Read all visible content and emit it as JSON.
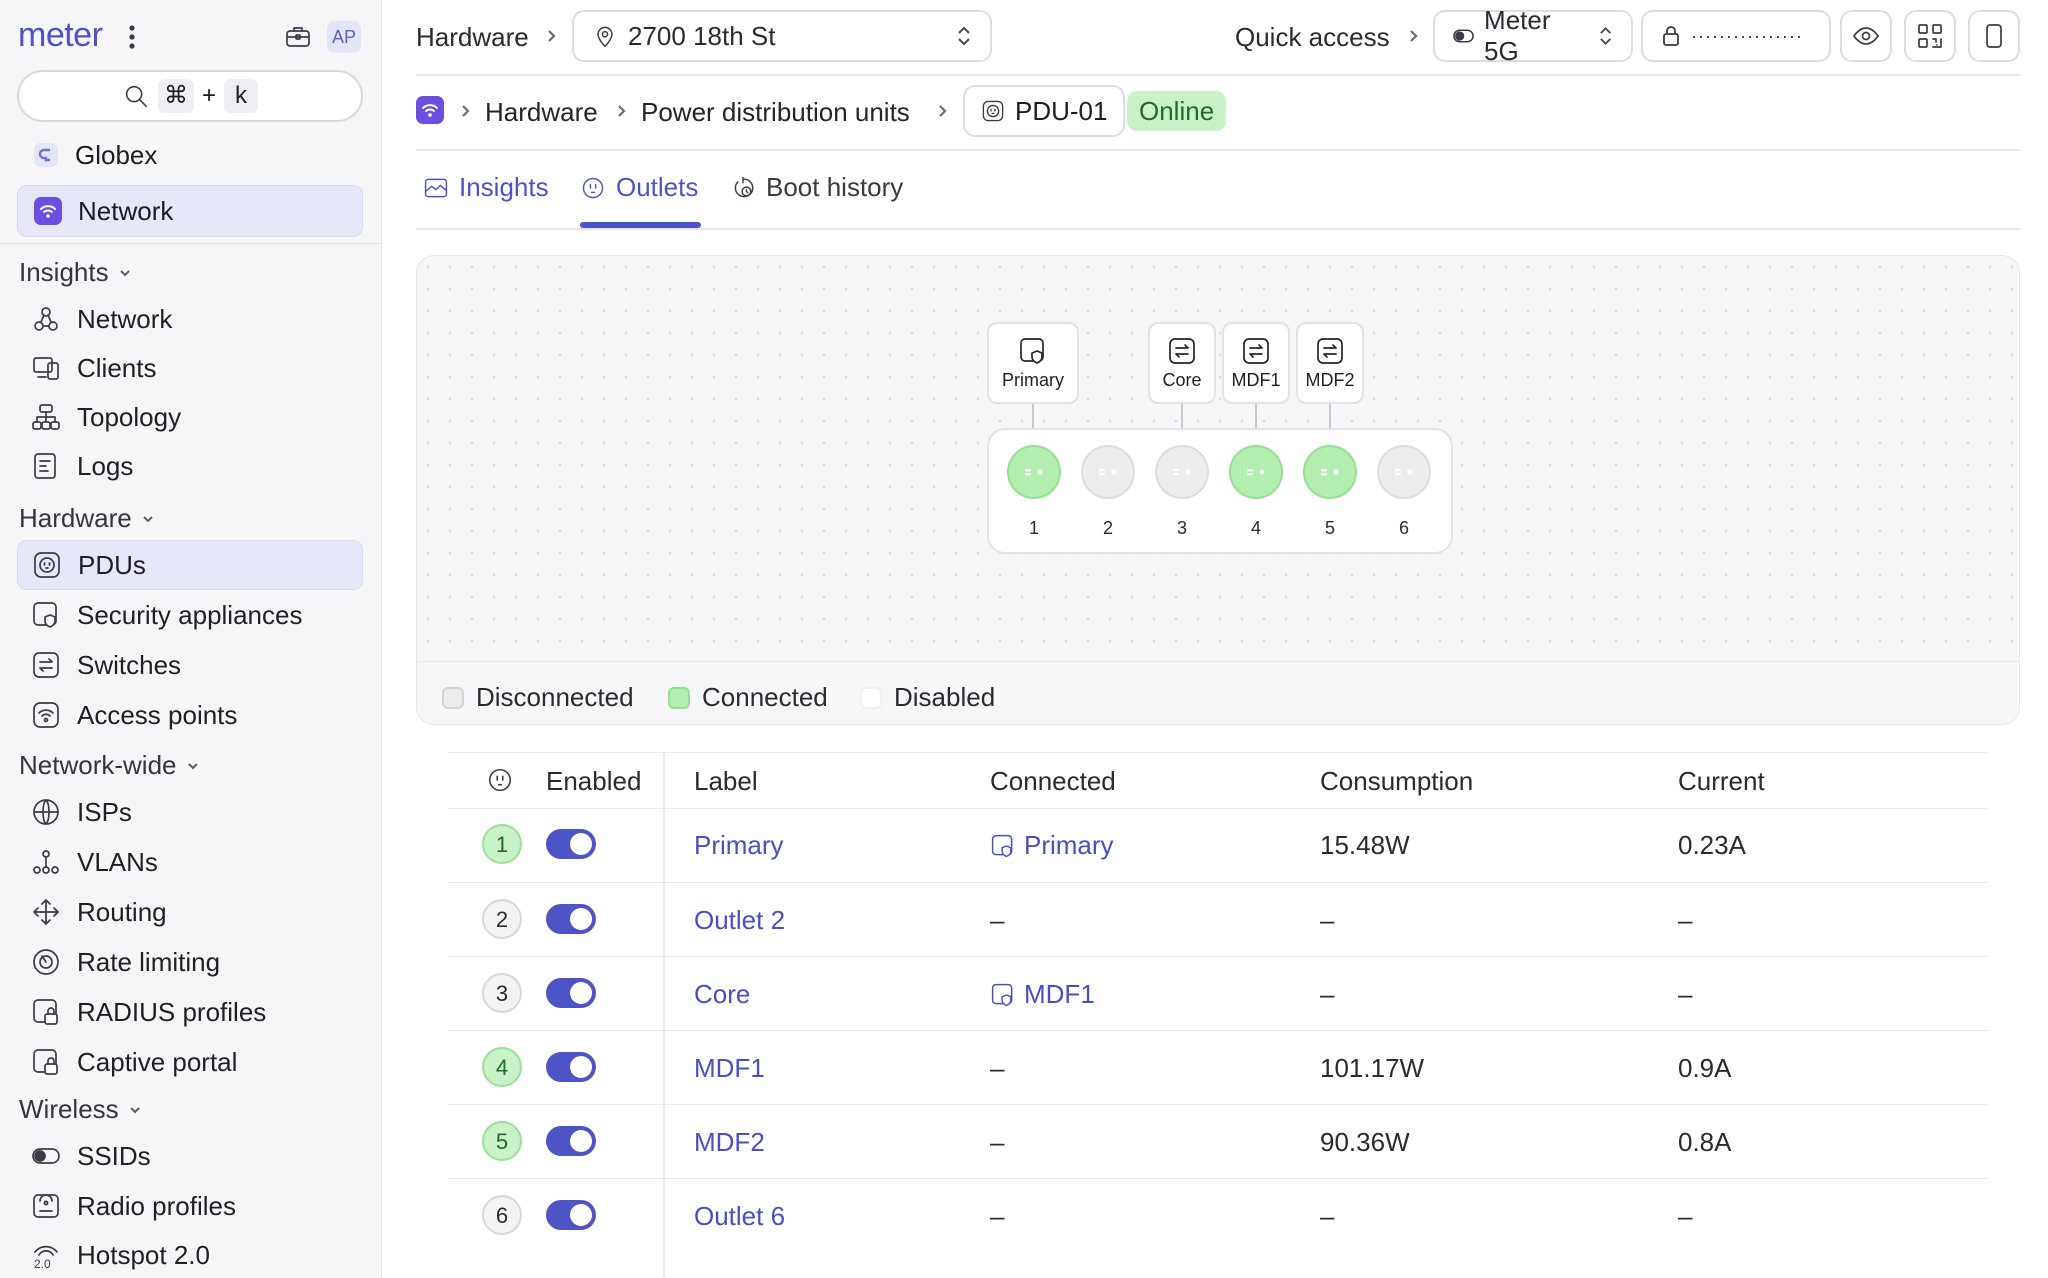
{
  "app": {
    "logo": "meter",
    "avatar": "AP"
  },
  "search": {
    "cmd": "⌘",
    "plus": "+",
    "key": "k"
  },
  "org": {
    "company": "Globex",
    "network": "Network"
  },
  "sidebar": {
    "sections": [
      {
        "title": "Insights",
        "items": [
          "Network",
          "Clients",
          "Topology",
          "Logs"
        ]
      },
      {
        "title": "Hardware",
        "items": [
          "PDUs",
          "Security appliances",
          "Switches",
          "Access points"
        ]
      },
      {
        "title": "Network-wide",
        "items": [
          "ISPs",
          "VLANs",
          "Routing",
          "Rate limiting",
          "RADIUS profiles",
          "Captive portal"
        ]
      },
      {
        "title": "Wireless",
        "items": [
          "SSIDs",
          "Radio profiles",
          "Hotspot 2.0"
        ]
      }
    ],
    "active_item": "PDUs"
  },
  "header": {
    "section": "Hardware",
    "location": "2700 18th St",
    "quick_access": "Quick access",
    "ssid": "Meter 5G",
    "password_mask": "················"
  },
  "breadcrumb": {
    "items": [
      "Hardware",
      "Power distribution units"
    ],
    "device": "PDU-01",
    "status": "Online"
  },
  "tabs": [
    {
      "label": "Insights",
      "icon": "insights-icon"
    },
    {
      "label": "Outlets",
      "icon": "outlet-icon",
      "active": true
    },
    {
      "label": "Boot history",
      "icon": "boot-history-icon"
    }
  ],
  "diagram": {
    "devices": [
      "Primary",
      "Core",
      "MDF1",
      "MDF2"
    ],
    "outlets": [
      {
        "num": "1",
        "state": "connected"
      },
      {
        "num": "2",
        "state": "disconnected"
      },
      {
        "num": "3",
        "state": "disconnected"
      },
      {
        "num": "4",
        "state": "connected"
      },
      {
        "num": "5",
        "state": "connected"
      },
      {
        "num": "6",
        "state": "disconnected"
      }
    ],
    "legend": [
      "Disconnected",
      "Connected",
      "Disabled"
    ]
  },
  "table": {
    "headers": [
      "Enabled",
      "Label",
      "Connected",
      "Consumption",
      "Current"
    ],
    "rows": [
      {
        "num": "1",
        "enabled": true,
        "label": "Primary",
        "connected": "Primary",
        "consumption": "15.48W",
        "current": "0.23A",
        "active": true
      },
      {
        "num": "2",
        "enabled": true,
        "label": "Outlet 2",
        "connected": "–",
        "consumption": "–",
        "current": "–",
        "active": false
      },
      {
        "num": "3",
        "enabled": true,
        "label": "Core",
        "connected": "MDF1",
        "consumption": "–",
        "current": "–",
        "active": false
      },
      {
        "num": "4",
        "enabled": true,
        "label": "MDF1",
        "connected": "–",
        "consumption": "101.17W",
        "current": "0.9A",
        "active": true
      },
      {
        "num": "5",
        "enabled": true,
        "label": "MDF2",
        "connected": "–",
        "consumption": "90.36W",
        "current": "0.8A",
        "active": true
      },
      {
        "num": "6",
        "enabled": true,
        "label": "Outlet 6",
        "connected": "–",
        "consumption": "–",
        "current": "–",
        "active": false
      }
    ]
  },
  "colors": {
    "accent": "#4d55c6",
    "connected": "#b3eeb0",
    "disconnected": "#ececef",
    "online_bg": "#c9f2c8"
  }
}
